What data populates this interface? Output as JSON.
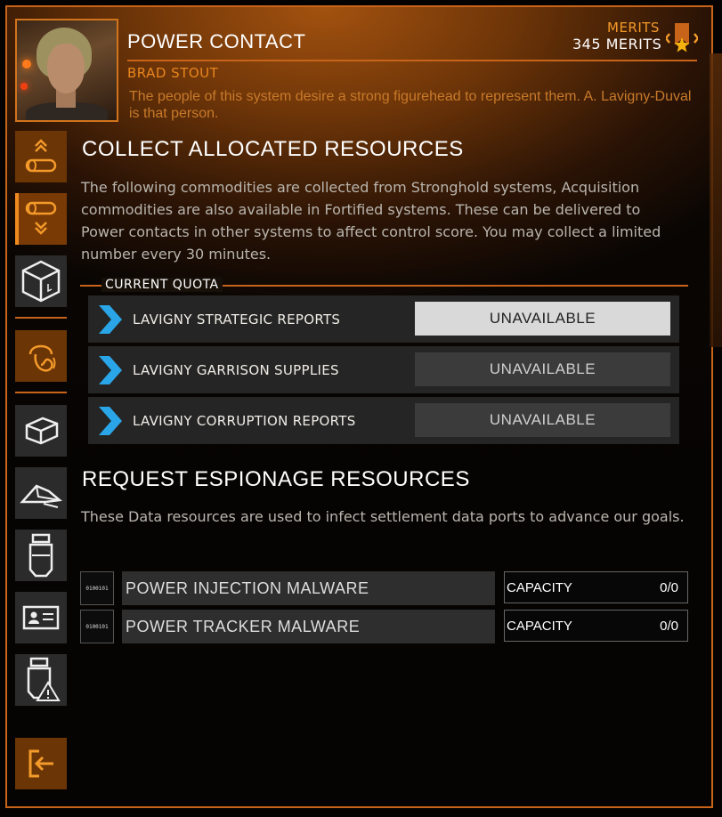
{
  "header": {
    "title": "POWER CONTACT",
    "name": "BRAD STOUT",
    "quote": "The people of this system desire a strong figurehead to represent them. A. Lavigny-Duval is that person.",
    "merits_label": "MERITS",
    "merits_value": "345 MERITS"
  },
  "nav": [
    {
      "icon": "collect-resources-icon",
      "active": false
    },
    {
      "icon": "deliver-resources-icon",
      "active": true
    },
    {
      "icon": "cargo-box-icon",
      "active": false
    },
    {
      "icon": "contact-headset-icon",
      "active": false
    },
    {
      "icon": "crate-icon",
      "active": false
    },
    {
      "icon": "wreckage-icon",
      "active": false
    },
    {
      "icon": "canister-icon",
      "active": false
    },
    {
      "icon": "id-card-icon",
      "active": false
    },
    {
      "icon": "hazard-canister-icon",
      "active": false
    },
    {
      "icon": "exit-icon",
      "active": false
    }
  ],
  "collect": {
    "title": "COLLECT ALLOCATED RESOURCES",
    "description": "The following commodities are collected from Stronghold systems, Acquisition commodities are also available in Fortified systems. These can be delivered to Power contacts in other systems to affect control score. You may collect a limited number every 30 minutes.",
    "quota_label": "CURRENT QUOTA",
    "rows": [
      {
        "name": "LAVIGNY STRATEGIC REPORTS",
        "status": "UNAVAILABLE"
      },
      {
        "name": "LAVIGNY GARRISON SUPPLIES",
        "status": "UNAVAILABLE"
      },
      {
        "name": "LAVIGNY CORRUPTION REPORTS",
        "status": "UNAVAILABLE"
      }
    ]
  },
  "espionage": {
    "title": "REQUEST ESPIONAGE RESOURCES",
    "description": "These Data resources are used to infect settlement data ports to advance our goals.",
    "rows": [
      {
        "binary": "0100101",
        "name": "POWER INJECTION MALWARE",
        "capacity_label": "CAPACITY",
        "capacity": "0/0"
      },
      {
        "binary": "0100101",
        "name": "POWER TRACKER MALWARE",
        "capacity_label": "CAPACITY",
        "capacity": "0/0"
      }
    ]
  },
  "colors": {
    "accent": "#c8641a",
    "accent_bright": "#f39a2a",
    "chevron_blue": "#2aa6e8"
  }
}
